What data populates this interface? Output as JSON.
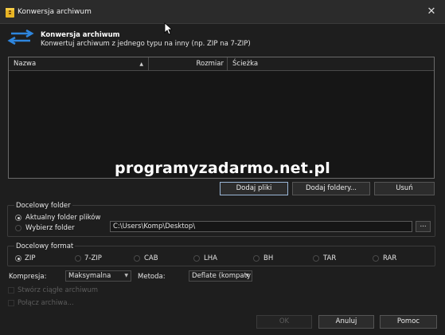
{
  "window": {
    "title": "Konwersja archiwum"
  },
  "header": {
    "title": "Konwersja archiwum",
    "subtitle": "Konwertuj archiwum z jednego typu na inny (np. ZIP na 7-ZIP)"
  },
  "file_list": {
    "columns": [
      "Nazwa",
      "Rozmiar",
      "Ścieżka"
    ],
    "sort_column": "Nazwa",
    "rows": []
  },
  "watermark": "programyzadarmo.net.pl",
  "list_buttons": {
    "add_files": "Dodaj pliki",
    "add_folders": "Dodaj foldery...",
    "remove": "Usuń"
  },
  "dest_folder": {
    "legend": "Docelowy folder",
    "current_label": "Aktualny folder plików",
    "choose_label": "Wybierz folder",
    "path_value": "C:\\Users\\Komp\\Desktop\\",
    "browse_label": "...",
    "selected": "current"
  },
  "dest_format": {
    "legend": "Docelowy format",
    "options": [
      "ZIP",
      "7-ZIP",
      "CAB",
      "LHA",
      "BH",
      "TAR",
      "RAR"
    ],
    "selected": "ZIP"
  },
  "options": {
    "compression_label": "Kompresja:",
    "compression_value": "Maksymalna",
    "method_label": "Metoda:",
    "method_value": "Deflate (kompaty",
    "solid_label": "Stwórz ciągłe archiwum",
    "merge_label": "Połącz archiwa..."
  },
  "footer": {
    "ok": "OK",
    "cancel": "Anuluj",
    "help": "Pomoc"
  },
  "colors": {
    "accent": "#2e86de",
    "background": "#1e1e1e",
    "focus_border": "#9ab6d6"
  }
}
